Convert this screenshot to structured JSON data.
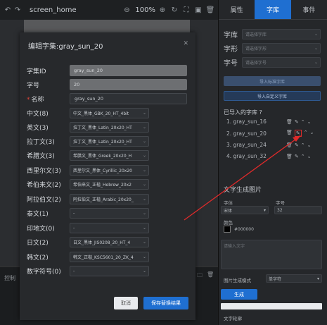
{
  "toolbar": {
    "title": "screen_home",
    "zoom": "100%"
  },
  "bottom_panel": {
    "label": "控制"
  },
  "right_panel": {
    "tabs": [
      {
        "label": "属性"
      },
      {
        "label": "字库"
      },
      {
        "label": "事件"
      }
    ],
    "rows": [
      {
        "label": "字库",
        "placeholder": "请选择字库"
      },
      {
        "label": "字形",
        "placeholder": "请选择字形"
      },
      {
        "label": "字号",
        "placeholder": "请选择字号"
      }
    ],
    "import_btn": "导入标准字库",
    "import_custom_btn": "导入自定义字库",
    "imported_title": "已导入的字库",
    "fonts": [
      {
        "index": "1.",
        "name": "gray_sun_16"
      },
      {
        "index": "2.",
        "name": "gray_sun_20"
      },
      {
        "index": "3.",
        "name": "gray_sun_24"
      },
      {
        "index": "4.",
        "name": "gray_sun_32"
      }
    ],
    "gen_section_title": "文字生成图片",
    "font_label": "字体",
    "size_label": "字号",
    "font_value": "宋体",
    "size_value": "32",
    "color_label": "颜色",
    "color_value": "#000000",
    "text_placeholder": "请输入文字",
    "gen_mode_label": "图片生成模式",
    "gen_mode_value": "单字符",
    "gen_btn": "生成",
    "outline_label": "文字轮廓"
  },
  "modal": {
    "title": "编辑字集:gray_sun_20",
    "fields": {
      "id_label": "字集ID",
      "id_value": "gray_sun_20",
      "num_label": "字号",
      "num_value": "20",
      "name_label": "名称",
      "name_value": "gray_sun_20"
    },
    "charsets": [
      {
        "label": "中文(8)",
        "value": "中文_黑体_GBK_20_HT_4bit"
      },
      {
        "label": "英文(3)",
        "value": "拉丁文_黑体_Latin_20x20_HT"
      },
      {
        "label": "拉丁文(3)",
        "value": "拉丁文_黑体_Latin_20x20_HT"
      },
      {
        "label": "希腊文(3)",
        "value": "希腊文_黑体_Greek_20x20_H"
      },
      {
        "label": "西里尔文(3)",
        "value": "西里尔文_黑体_Cyrillic_20x20"
      },
      {
        "label": "希伯来文(2)",
        "value": "希伯来文_正楷_Hebrew_20x2"
      },
      {
        "label": "阿拉伯文(2)",
        "value": "阿拉伯文_正楷_Arabic_20x20_"
      },
      {
        "label": "泰文(1)",
        "value": "-"
      },
      {
        "label": "印地文(0)",
        "value": "-"
      },
      {
        "label": "日文(2)",
        "value": "日文_黑体_JIS0208_20_HT_4"
      },
      {
        "label": "韩文(2)",
        "value": "韩文_正楷_KSC5601_20_ZK_4"
      },
      {
        "label": "数字符号(0)",
        "value": "-"
      }
    ],
    "cancel_btn": "取消",
    "save_btn": "保存替换结果"
  },
  "colors": {
    "accent": "#1f6fd1",
    "highlight": "#e02a2a"
  }
}
